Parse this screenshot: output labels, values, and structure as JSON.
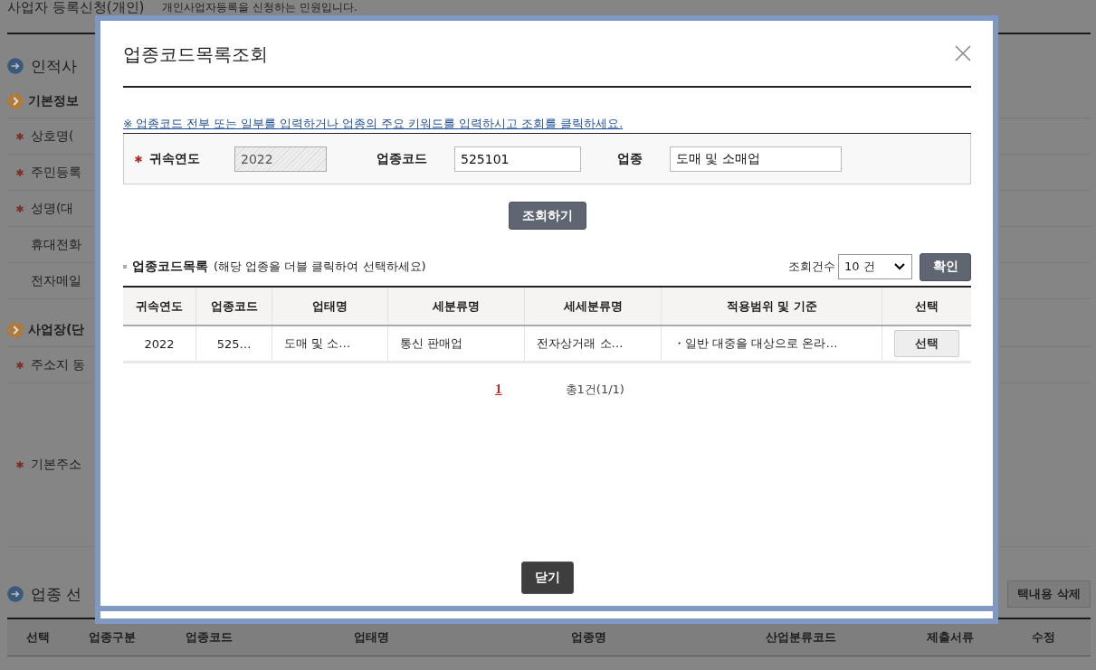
{
  "page": {
    "title": "사업자 등록신청(개인)",
    "subtitle": "개인사업자등록을 신청하는 민원입니다.",
    "sections": [
      {
        "title": "인적사",
        "groups": [
          {
            "title": "기본정보",
            "rows": [
              {
                "label": "상호명(",
                "required": true,
                "tall": false
              },
              {
                "label": "주민등록",
                "required": true,
                "tall": false
              },
              {
                "label": "성명(대",
                "required": true,
                "tall": false
              },
              {
                "label": "휴대전화",
                "required": false,
                "tall": false
              },
              {
                "label": "전자메일",
                "required": false,
                "tall": false
              }
            ]
          },
          {
            "title": "사업장(단",
            "rows": [
              {
                "label": "주소지 동",
                "required": true,
                "tall": false
              },
              {
                "label": "기본주소",
                "required": true,
                "tall": true
              }
            ]
          }
        ]
      }
    ],
    "business": {
      "title": "업종 선",
      "delete_button": "택내용 삭제",
      "columns": [
        "선택",
        "업종구분",
        "업종코드",
        "업태명",
        "업종명",
        "산업분류코드",
        "제출서류",
        "수정"
      ]
    }
  },
  "dialog": {
    "title": "업종코드목록조회",
    "notice": "※ 업종코드 전부 또는 일부를 입력하거나 업종의 주요 키워드를 입력하시고 조회를 클릭하세요.",
    "fields": [
      {
        "label": "귀속연도",
        "value": "2022",
        "required": true,
        "disabled": true
      },
      {
        "label": "업종코드",
        "value": "525101",
        "required": false,
        "disabled": false
      },
      {
        "label": "업종",
        "value": "도매 및 소매업",
        "required": false,
        "disabled": false
      }
    ],
    "search_button": "조회하기",
    "list_title": "업종코드목록",
    "list_hint": "(해당 업종을 더블 클릭하여 선택하세요)",
    "count_label": "조회건수",
    "count_value": "10 건",
    "confirm_button": "확인",
    "columns": [
      "귀속연도",
      "업종코드",
      "업태명",
      "세분류명",
      "세세분류명",
      "적용범위 및 기준",
      "선택"
    ],
    "rows": [
      {
        "cells": [
          "2022",
          "525…",
          "도매 및 소…",
          "통신 판매업",
          "전자상거래 소…",
          "・일반 대중을 대상으로 온라…"
        ],
        "button": "선택"
      }
    ],
    "pages": [
      {
        "label": "1",
        "selected": true
      }
    ],
    "total": "총1건(1/1)",
    "close_button": "닫기"
  }
}
